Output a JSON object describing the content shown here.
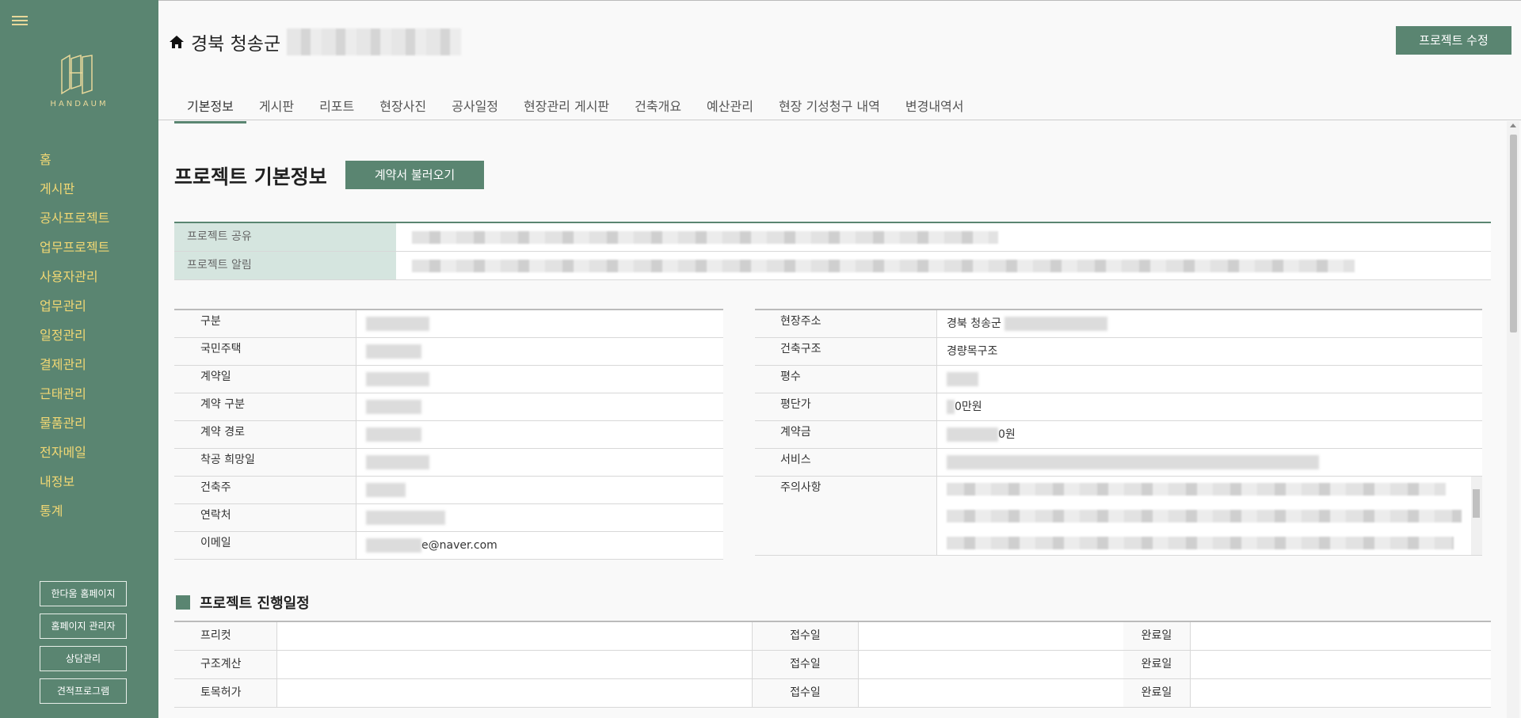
{
  "sidebar": {
    "logo_text": "HANDAUM",
    "nav": [
      "홈",
      "게시판",
      "공사프로젝트",
      "업무프로젝트",
      "사용자관리",
      "업무관리",
      "일정관리",
      "결제관리",
      "근태관리",
      "물품관리",
      "전자메일",
      "내정보",
      "통계"
    ],
    "buttons": [
      "한다움 홈페이지",
      "홈페이지 관리자",
      "상담관리",
      "견적프로그램"
    ]
  },
  "header": {
    "title": "경북 청송군",
    "edit_button": "프로젝트 수정"
  },
  "tabs": [
    "기본정보",
    "게시판",
    "리포트",
    "현장사진",
    "공사일정",
    "현장관리 게시판",
    "건축개요",
    "예산관리",
    "현장 기성청구 내역",
    "변경내역서"
  ],
  "main": {
    "section_title": "프로젝트 기본정보",
    "contract_button": "계약서 불러오기",
    "share_rows": [
      "프로젝트 공유",
      "프로젝트 알림"
    ],
    "left_table": [
      {
        "label": "구분",
        "value": ""
      },
      {
        "label": "국민주택",
        "value": ""
      },
      {
        "label": "계약일",
        "value": ""
      },
      {
        "label": "계약 구분",
        "value": ""
      },
      {
        "label": "계약 경로",
        "value": ""
      },
      {
        "label": "착공 희망일",
        "value": ""
      },
      {
        "label": "건축주",
        "value": ""
      },
      {
        "label": "연락처",
        "value": ""
      },
      {
        "label": "이메일",
        "value": "e@naver.com"
      }
    ],
    "right_table": [
      {
        "label": "현장주소",
        "value": "경북 청송군"
      },
      {
        "label": "건축구조",
        "value": "경량목구조"
      },
      {
        "label": "평수",
        "value": ""
      },
      {
        "label": "평단가",
        "value": "0만원"
      },
      {
        "label": "계약금",
        "value": "0원"
      },
      {
        "label": "서비스",
        "value": ""
      }
    ],
    "notes_label": "주의사항",
    "schedule": {
      "title": "프로젝트 진행일정",
      "receipt_label": "접수일",
      "complete_label": "완료일",
      "rows": [
        "프리컷",
        "구조계산",
        "토목허가"
      ]
    }
  },
  "colors": {
    "sidebar_bg": "#5a8571",
    "nav_text": "#f2d874",
    "accent": "#5a8571",
    "share_label_bg": "#d5e5df"
  }
}
